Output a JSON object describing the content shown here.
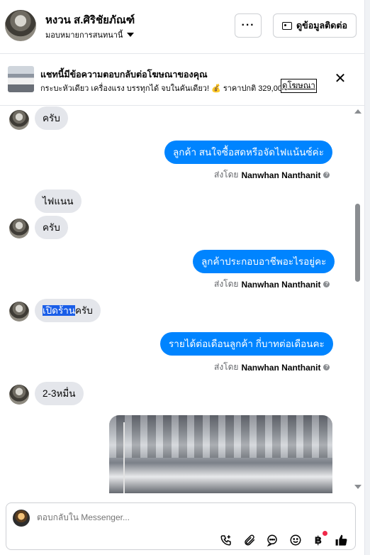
{
  "header": {
    "contact_name": "หงวน ส.ศิริชัยภัณฑ์",
    "assignee_label": "มอบหมายการสนทนานี้",
    "more_label": "···",
    "view_contact_label": "ดูข้อมูลติดต่อ"
  },
  "ad": {
    "title": "แชทนี้มีข้อความตอบกลับต่อโฆษณาของคุณ",
    "body": "กระบะหัวเดียว เครื่องแรง บรรทุกได้ จบในคันเดียว! 💰 ราคาปกติ 329,000 ...",
    "link_label": "ดูโฆษณา",
    "close_label": "✕"
  },
  "messages": [
    {
      "side": "in",
      "text": "ครับ"
    },
    {
      "side": "out",
      "text": "ลูกค้า สนใจซื้อสดหรือจัดไฟแน้นซ์ค่ะ",
      "sent_prefix": "ส่งโดย",
      "sender": "Nanwhan Nanthanit"
    },
    {
      "side": "in",
      "text": "ไฟแนน"
    },
    {
      "side": "in",
      "text": "ครับ"
    },
    {
      "side": "out",
      "text": "ลูกค้าประกอบอาชีพอะไรอยู่คะ",
      "sent_prefix": "ส่งโดย",
      "sender": "Nanwhan Nanthanit"
    },
    {
      "side": "in",
      "text_highlight": "เปิดร้าน",
      "text_rest": "ครับ"
    },
    {
      "side": "out",
      "text": "รายได้ต่อเดือนลูกค้า กี่บาทต่อเดือนคะ",
      "sent_prefix": "ส่งโดย",
      "sender": "Nanwhan Nanthanit"
    },
    {
      "side": "in",
      "text": "2-3หมื่น"
    }
  ],
  "composer": {
    "placeholder": "ตอบกลับใน Messenger..."
  },
  "icons": {
    "call": "phone-plus-icon",
    "attach": "paperclip-icon",
    "saved_replies": "chat-bubble-icon",
    "emoji": "emoji-icon",
    "payment": "baht-icon",
    "like": "thumbs-up-icon"
  },
  "colors": {
    "outgoing_bubble": "#0084ff",
    "incoming_bubble": "#e4e6eb",
    "highlight": "#1a5ee8",
    "notification": "#f02849"
  }
}
